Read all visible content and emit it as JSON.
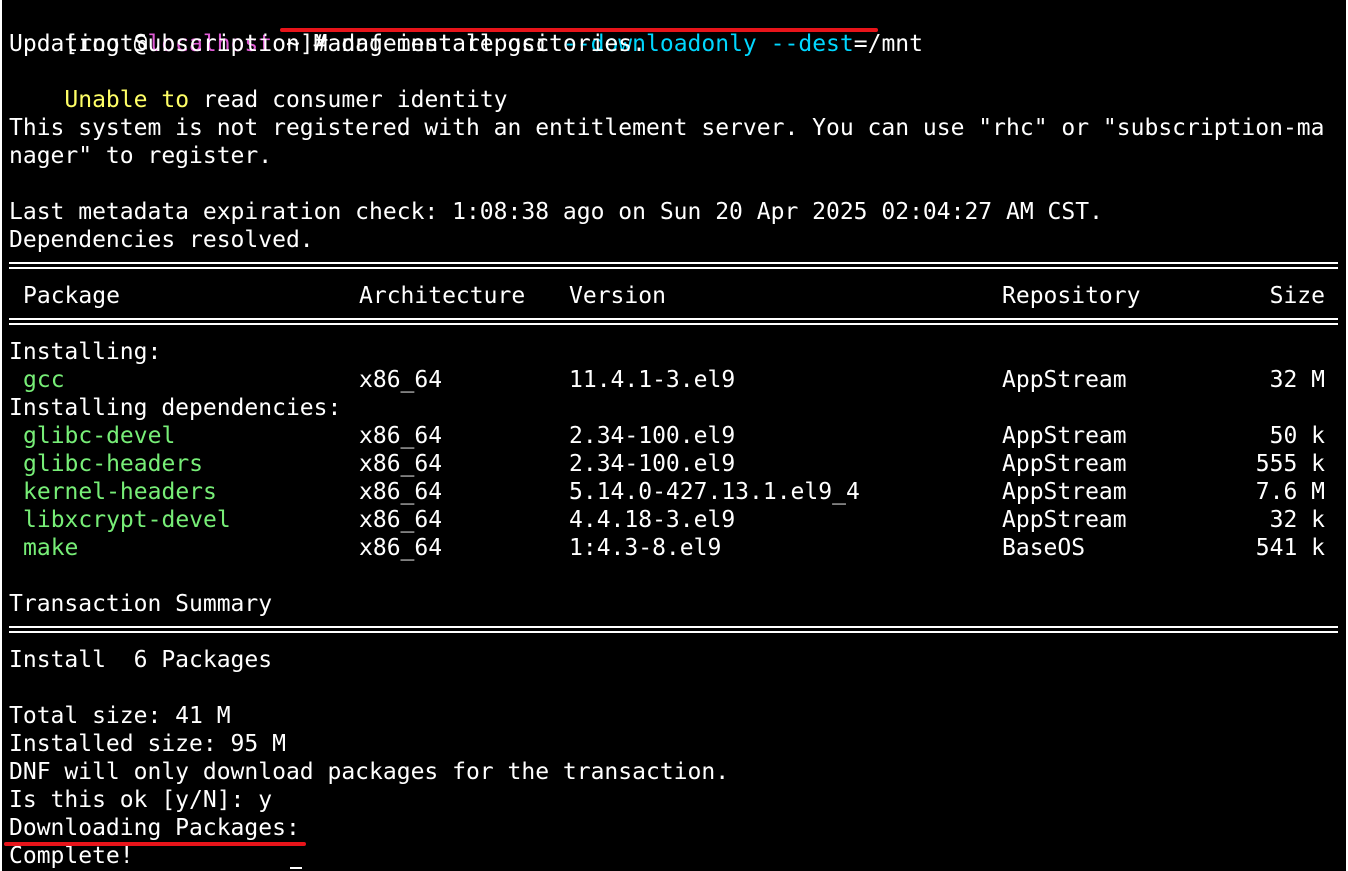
{
  "colors": {
    "background": "#000000",
    "text": "#ffffff",
    "prompt_host": "#e05cd6",
    "option_cyan": "#00d7ff",
    "warning_yellow": "#ffff66",
    "package_green": "#77ee77",
    "annotation_red": "#e8141a"
  },
  "prompt": {
    "open": "[root@",
    "host": "localhost",
    "rest": " ~]# ",
    "cmd_main": "dnf install gcc ",
    "opt1": "--downloadonly",
    "space": " ",
    "opt2": "--dest",
    "opt2_value": "=/mnt"
  },
  "output": {
    "updating": "Updating Subscription Management repositories.",
    "unable_word1": "Unable",
    "unable_space": " ",
    "unable_word2": "to",
    "unable_rest": " read consumer identity",
    "notice_line1": "This system is not registered with an entitlement server. You can use \"rhc\" or \"subscription-ma",
    "notice_line2": "nager\" to register.",
    "metadata": "Last metadata expiration check: 1:08:38 ago on Sun 20 Apr 2025 02:04:27 AM CST.",
    "resolved": "Dependencies resolved."
  },
  "table": {
    "headers": [
      "Package",
      "Architecture",
      "Version",
      "Repository",
      "Size"
    ],
    "installing_label": "Installing:",
    "installing": [
      {
        "name": "gcc",
        "arch": "x86_64",
        "version": "11.4.1-3.el9",
        "repo": "AppStream",
        "size": "32 M"
      }
    ],
    "deps_label": "Installing dependencies:",
    "dependencies": [
      {
        "name": "glibc-devel",
        "arch": "x86_64",
        "version": "2.34-100.el9",
        "repo": "AppStream",
        "size": "50 k"
      },
      {
        "name": "glibc-headers",
        "arch": "x86_64",
        "version": "2.34-100.el9",
        "repo": "AppStream",
        "size": "555 k"
      },
      {
        "name": "kernel-headers",
        "arch": "x86_64",
        "version": "5.14.0-427.13.1.el9_4",
        "repo": "AppStream",
        "size": "7.6 M"
      },
      {
        "name": "libxcrypt-devel",
        "arch": "x86_64",
        "version": "4.4.18-3.el9",
        "repo": "AppStream",
        "size": "32 k"
      },
      {
        "name": "make",
        "arch": "x86_64",
        "version": "1:4.3-8.el9",
        "repo": "BaseOS",
        "size": "541 k"
      }
    ]
  },
  "summary": {
    "title": "Transaction Summary",
    "install": "Install  6 Packages",
    "total_size": "Total size: 41 M",
    "installed_size": "Installed size: 95 M",
    "download_only_note": "DNF will only download packages for the transaction.",
    "confirm_prompt": "Is this ok [y/N]: y",
    "downloading": "Downloading Packages:",
    "complete": "Complete!"
  }
}
